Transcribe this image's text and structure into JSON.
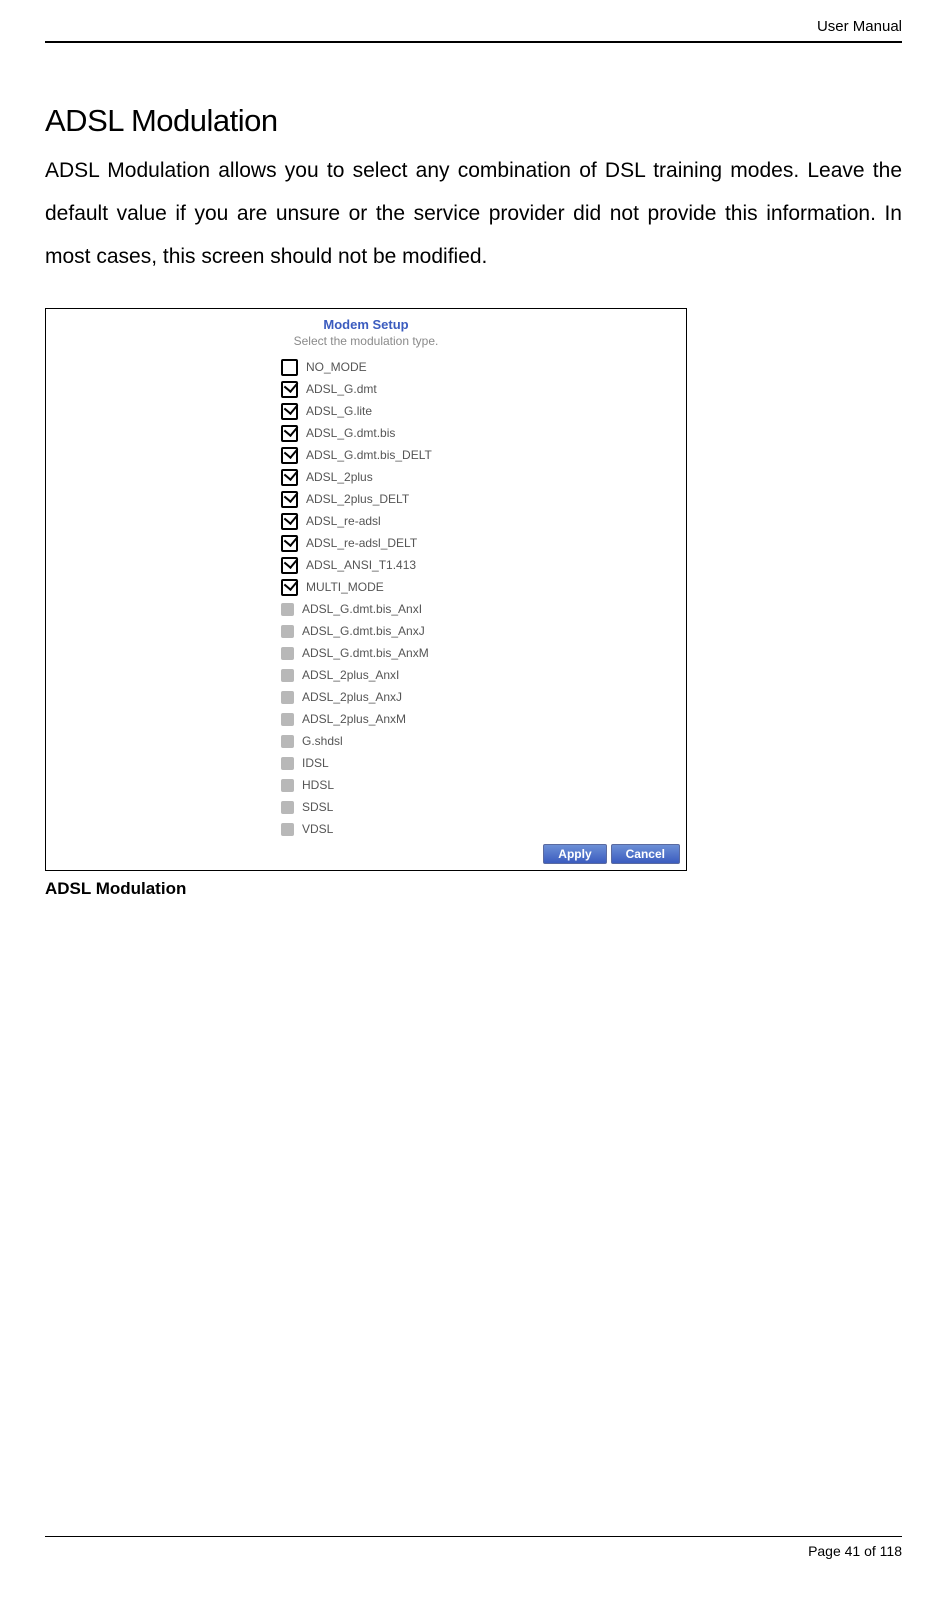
{
  "header": {
    "doc_title": "User Manual"
  },
  "section": {
    "title": "ADSL Modulation",
    "intro": "ADSL Modulation allows you to select any combination of DSL training modes. Leave the default value if you are unsure or the service provider did not provide this information. In most cases, this screen should not be modified."
  },
  "modem_panel": {
    "title": "Modem Setup",
    "subtitle": "Select the modulation type.",
    "options": [
      {
        "label": "NO_MODE",
        "state": "empty"
      },
      {
        "label": "ADSL_G.dmt",
        "state": "checked"
      },
      {
        "label": "ADSL_G.lite",
        "state": "checked"
      },
      {
        "label": "ADSL_G.dmt.bis",
        "state": "checked"
      },
      {
        "label": "ADSL_G.dmt.bis_DELT",
        "state": "checked"
      },
      {
        "label": "ADSL_2plus",
        "state": "checked"
      },
      {
        "label": "ADSL_2plus_DELT",
        "state": "checked"
      },
      {
        "label": "ADSL_re-adsl",
        "state": "checked"
      },
      {
        "label": "ADSL_re-adsl_DELT",
        "state": "checked"
      },
      {
        "label": "ADSL_ANSI_T1.413",
        "state": "checked"
      },
      {
        "label": "MULTI_MODE",
        "state": "checked"
      },
      {
        "label": "ADSL_G.dmt.bis_AnxI",
        "state": "grey"
      },
      {
        "label": "ADSL_G.dmt.bis_AnxJ",
        "state": "grey"
      },
      {
        "label": "ADSL_G.dmt.bis_AnxM",
        "state": "grey"
      },
      {
        "label": "ADSL_2plus_AnxI",
        "state": "grey"
      },
      {
        "label": "ADSL_2plus_AnxJ",
        "state": "grey"
      },
      {
        "label": "ADSL_2plus_AnxM",
        "state": "grey"
      },
      {
        "label": "G.shdsl",
        "state": "grey"
      },
      {
        "label": "IDSL",
        "state": "grey"
      },
      {
        "label": "HDSL",
        "state": "grey"
      },
      {
        "label": "SDSL",
        "state": "grey"
      },
      {
        "label": "VDSL",
        "state": "grey"
      }
    ],
    "apply_label": "Apply",
    "cancel_label": "Cancel"
  },
  "caption": "ADSL Modulation",
  "footer": {
    "page_label": "Page 41 of 118"
  }
}
